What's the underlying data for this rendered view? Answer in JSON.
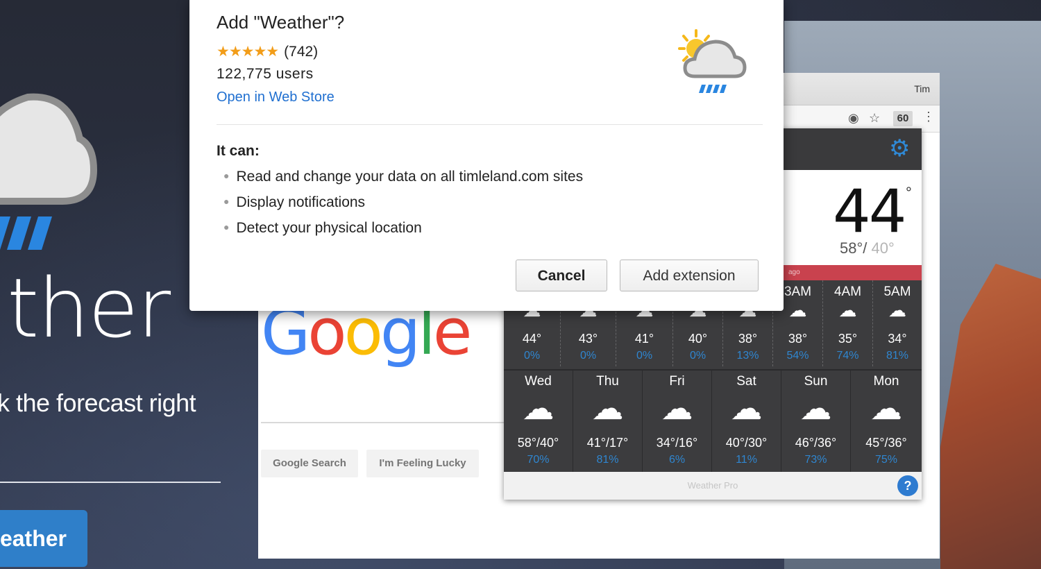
{
  "dialog": {
    "title": "Add \"Weather\"?",
    "stars": "★★★★★",
    "rating_count": "(742)",
    "users": "122,775 users",
    "store_link": "Open in Web Store",
    "it_can": "It can:",
    "permissions": [
      "Read and change your data on all timleland.com sites",
      "Display notifications",
      "Detect your physical location"
    ],
    "cancel_label": "Cancel",
    "add_label": "Add extension"
  },
  "background": {
    "title_fragment": "ther",
    "tagline_fragment": "k the forecast right",
    "button_fragment": "eather"
  },
  "browser": {
    "profile_name": "Tim",
    "extension_badge": "60",
    "google_buttons": [
      "Google Search",
      "I'm Feeling Lucky"
    ]
  },
  "weather": {
    "current_temp": "44",
    "degree_symbol": "°",
    "high": "58°/",
    "low": " 40°",
    "alert_text": "ago",
    "hourly": [
      {
        "label": "",
        "temp": "44°",
        "precip": "0%"
      },
      {
        "label": "",
        "temp": "43°",
        "precip": "0%"
      },
      {
        "label": "",
        "temp": "41°",
        "precip": "0%"
      },
      {
        "label": "",
        "temp": "40°",
        "precip": "0%"
      },
      {
        "label": "",
        "temp": "38°",
        "precip": "13%"
      },
      {
        "label": "3AM",
        "temp": "38°",
        "precip": "54%"
      },
      {
        "label": "4AM",
        "temp": "35°",
        "precip": "74%"
      },
      {
        "label": "5AM",
        "temp": "34°",
        "precip": "81%"
      }
    ],
    "daily": [
      {
        "label": "Wed",
        "temp": "58°/40°",
        "precip": "70%"
      },
      {
        "label": "Thu",
        "temp": "41°/17°",
        "precip": "81%"
      },
      {
        "label": "Fri",
        "temp": "34°/16°",
        "precip": "6%"
      },
      {
        "label": "Sat",
        "temp": "40°/30°",
        "precip": "11%"
      },
      {
        "label": "Sun",
        "temp": "46°/36°",
        "precip": "73%"
      },
      {
        "label": "Mon",
        "temp": "45°/36°",
        "precip": "75%"
      }
    ],
    "footer_brand": "Weather Pro",
    "help_label": "?"
  },
  "colors": {
    "accent_blue": "#2f86d0",
    "alert_red": "#c9424e",
    "star_orange": "#f29d19"
  },
  "icons": [
    "cloud-rain-icon",
    "sun-cloud-rain-icon",
    "gear-icon",
    "help-icon",
    "star-icon",
    "location-icon",
    "kebab-menu-icon",
    "cloud-icon"
  ]
}
